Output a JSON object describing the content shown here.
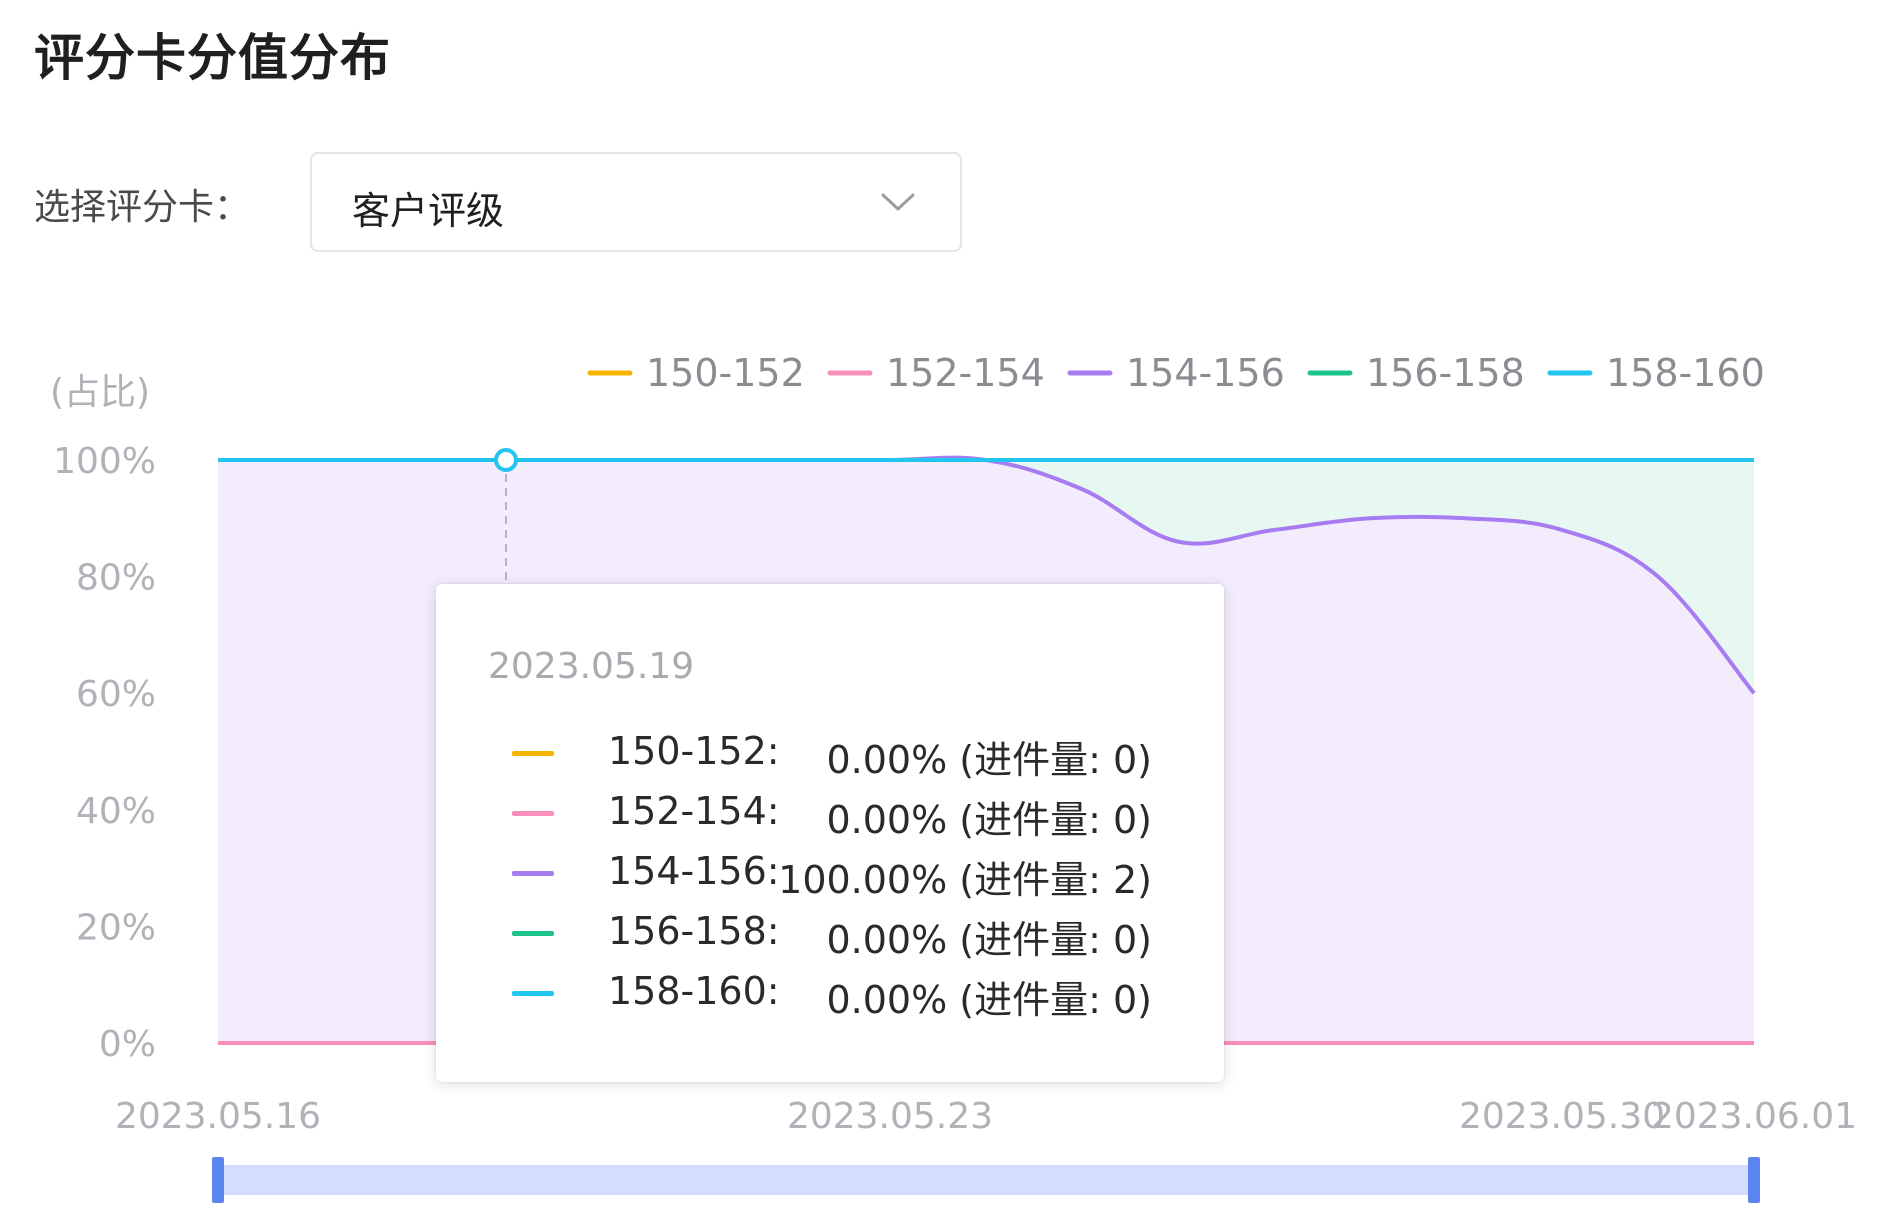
{
  "title": "评分卡分值分布",
  "selector": {
    "label": "选择评分卡：",
    "value": "客户评级",
    "chevron_icon": "chevron-down-icon"
  },
  "chart_data": {
    "type": "area",
    "stacked": true,
    "y_unit_label": "(占比)",
    "x_tick_labels": [
      "2023.05.16",
      "2023.05.23",
      "2023.05.30",
      "2023.06.01"
    ],
    "y_tick_labels": [
      "0%",
      "20%",
      "40%",
      "60%",
      "80%",
      "100%"
    ],
    "ylim": [
      0,
      100
    ],
    "grid": true,
    "legend_position": "top-right",
    "x": [
      "2023.05.16",
      "2023.05.17",
      "2023.05.18",
      "2023.05.19",
      "2023.05.20",
      "2023.05.21",
      "2023.05.22",
      "2023.05.23",
      "2023.05.24",
      "2023.05.25",
      "2023.05.26",
      "2023.05.27",
      "2023.05.28",
      "2023.05.29",
      "2023.05.30",
      "2023.05.31",
      "2023.06.01"
    ],
    "series": [
      {
        "name": "150-152",
        "color": "#f5b400",
        "values": [
          0,
          0,
          0,
          0,
          0,
          0,
          0,
          0,
          0,
          0,
          0,
          0,
          0,
          0,
          0,
          0,
          0
        ]
      },
      {
        "name": "152-154",
        "color": "#f78fba",
        "values": [
          0,
          0,
          0,
          0,
          0,
          0,
          0,
          0,
          0,
          0,
          0,
          0,
          0,
          0,
          0,
          0,
          0
        ]
      },
      {
        "name": "154-156",
        "color": "#a77cf0",
        "values": [
          100,
          100,
          100,
          100,
          100,
          100,
          100,
          100,
          100,
          95,
          86,
          88,
          90,
          90,
          88,
          80,
          60
        ]
      },
      {
        "name": "156-158",
        "color": "#1dc48a",
        "values": [
          0,
          0,
          0,
          0,
          0,
          0,
          0,
          0,
          0,
          5,
          14,
          12,
          10,
          10,
          12,
          20,
          40
        ]
      },
      {
        "name": "158-160",
        "color": "#22c4f0",
        "values": [
          0,
          0,
          0,
          0,
          0,
          0,
          0,
          0,
          0,
          0,
          0,
          0,
          0,
          0,
          0,
          0,
          0
        ]
      }
    ],
    "hover": {
      "index": 3,
      "x": "2023.05.19"
    },
    "zoom_slider": {
      "start": 0,
      "end": 100
    }
  },
  "tooltip": {
    "date": "2023.05.19",
    "rows": [
      {
        "name": "150-152:",
        "value": "0.00% (进件量: 0)",
        "color": "#f5b400"
      },
      {
        "name": "152-154:",
        "value": "0.00% (进件量: 0)",
        "color": "#f78fba"
      },
      {
        "name": "154-156:",
        "value": "100.00% (进件量: 2)",
        "color": "#a77cf0"
      },
      {
        "name": "156-158:",
        "value": "0.00% (进件量: 0)",
        "color": "#1dc48a"
      },
      {
        "name": "158-160:",
        "value": "0.00% (进件量: 0)",
        "color": "#22c4f0"
      }
    ]
  }
}
